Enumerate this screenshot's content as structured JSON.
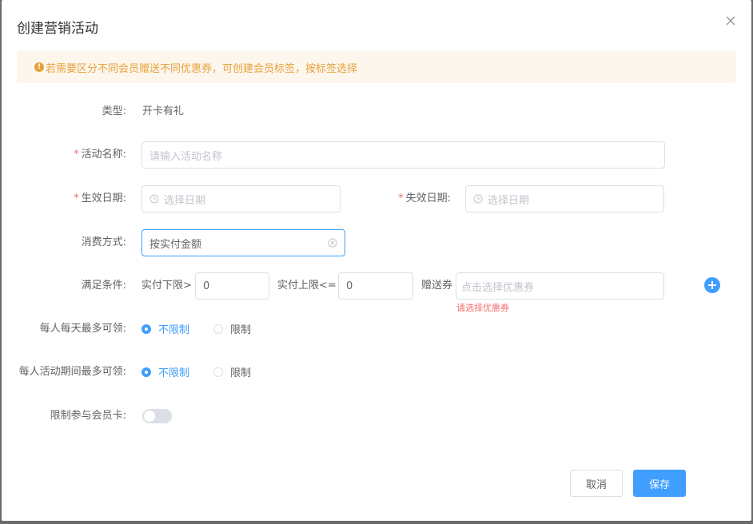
{
  "dialog": {
    "title": "创建营销活动"
  },
  "alert": {
    "text": "若需要区分不同会员赠送不同优惠券，可创建会员标签，按标签选择",
    "icon": "warning-icon"
  },
  "form": {
    "type": {
      "label": "类型:",
      "value": "开卡有礼"
    },
    "name": {
      "label": "活动名称:",
      "placeholder": "请输入活动名称"
    },
    "start_date": {
      "label": "生效日期:",
      "placeholder": "选择日期"
    },
    "end_date": {
      "label": "失效日期:",
      "placeholder": "选择日期"
    },
    "consumption": {
      "label": "消费方式:",
      "value": "按实付金额"
    },
    "condition": {
      "label": "满足条件:",
      "lower_label": "实付下限>",
      "lower_value": "0",
      "upper_label": "实付上限<=",
      "upper_value": "0",
      "gift_label": "赠送券",
      "gift_placeholder": "点击选择优惠券",
      "error": "请选择优惠券"
    },
    "daily_limit": {
      "label": "每人每天最多可领:",
      "options": [
        "不限制",
        "限制"
      ],
      "selected": "不限制"
    },
    "period_limit": {
      "label": "每人活动期间最多可领:",
      "options": [
        "不限制",
        "限制"
      ],
      "selected": "不限制"
    },
    "card_limit": {
      "label": "限制参与会员卡:",
      "enabled": false
    }
  },
  "buttons": {
    "cancel": "取消",
    "save": "保存"
  },
  "colors": {
    "primary": "#409eff",
    "warning": "#e6a23c",
    "warning_bg": "#fdf6ec",
    "error": "#f56c6c"
  }
}
